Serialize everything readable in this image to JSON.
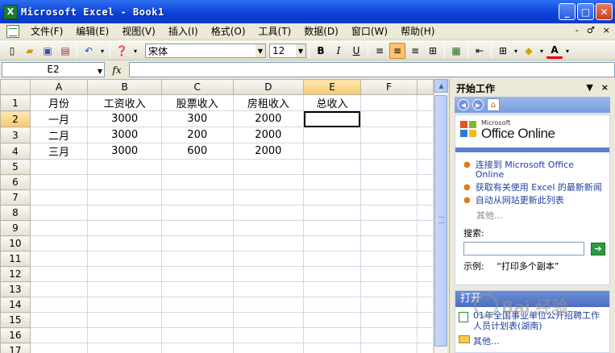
{
  "window": {
    "title": "Microsoft Excel - Book1",
    "app_icon": "X",
    "buttons": {
      "minimize": "_",
      "maximize": "□",
      "close": "✕"
    }
  },
  "menu": {
    "items": [
      "文件(F)",
      "编辑(E)",
      "视图(V)",
      "插入(I)",
      "格式(O)",
      "工具(T)",
      "数据(D)",
      "窗口(W)",
      "帮助(H)"
    ],
    "doc_controls": [
      "-",
      "♂",
      "×"
    ]
  },
  "toolbar": {
    "font_name": "宋体",
    "font_size": "12",
    "bold": "B",
    "italic": "I",
    "underline": "U",
    "font_color_label": "A"
  },
  "formula_bar": {
    "name_box": "E2",
    "fx_label": "fx",
    "value": ""
  },
  "sheet": {
    "columns": [
      "A",
      "B",
      "C",
      "D",
      "E",
      "F"
    ],
    "selected_column": "E",
    "selected_row": "2",
    "rows": [
      {
        "num": "1",
        "cells": [
          "月份",
          "工资收入",
          "股票收入",
          "房租收入",
          "总收入",
          ""
        ]
      },
      {
        "num": "2",
        "cells": [
          "一月",
          "3000",
          "300",
          "2000",
          "",
          ""
        ]
      },
      {
        "num": "3",
        "cells": [
          "二月",
          "3000",
          "200",
          "2000",
          "",
          ""
        ]
      },
      {
        "num": "4",
        "cells": [
          "三月",
          "3000",
          "600",
          "2000",
          "",
          ""
        ]
      },
      {
        "num": "5",
        "cells": [
          "",
          "",
          "",
          "",
          "",
          ""
        ]
      },
      {
        "num": "6",
        "cells": [
          "",
          "",
          "",
          "",
          "",
          ""
        ]
      },
      {
        "num": "7",
        "cells": [
          "",
          "",
          "",
          "",
          "",
          ""
        ]
      },
      {
        "num": "8",
        "cells": [
          "",
          "",
          "",
          "",
          "",
          ""
        ]
      },
      {
        "num": "9",
        "cells": [
          "",
          "",
          "",
          "",
          "",
          ""
        ]
      },
      {
        "num": "10",
        "cells": [
          "",
          "",
          "",
          "",
          "",
          ""
        ]
      },
      {
        "num": "11",
        "cells": [
          "",
          "",
          "",
          "",
          "",
          ""
        ]
      },
      {
        "num": "12",
        "cells": [
          "",
          "",
          "",
          "",
          "",
          ""
        ]
      },
      {
        "num": "13",
        "cells": [
          "",
          "",
          "",
          "",
          "",
          ""
        ]
      },
      {
        "num": "14",
        "cells": [
          "",
          "",
          "",
          "",
          "",
          ""
        ]
      },
      {
        "num": "15",
        "cells": [
          "",
          "",
          "",
          "",
          "",
          ""
        ]
      },
      {
        "num": "16",
        "cells": [
          "",
          "",
          "",
          "",
          "",
          ""
        ]
      },
      {
        "num": "17",
        "cells": [
          "",
          "",
          "",
          "",
          "",
          ""
        ]
      }
    ]
  },
  "task_pane": {
    "title": "开始工作",
    "controls": [
      "▼",
      "×"
    ],
    "logo_small": "Microsoft",
    "logo_big": "Office Online",
    "links": [
      "连接到 Microsoft Office Online",
      "获取有关使用 Excel 的最新新闻",
      "自动从网站更新此列表"
    ],
    "more": "其他...",
    "search_label": "搜索:",
    "search_placeholder": "",
    "example_label": "示例:",
    "example_value": "“打印多个副本”",
    "open_title": "打开",
    "recent_file": "01年全国事业单位公开招聘工作人员计划表(湖南)",
    "open_more": "其他..."
  },
  "watermark": "Bai 经验"
}
